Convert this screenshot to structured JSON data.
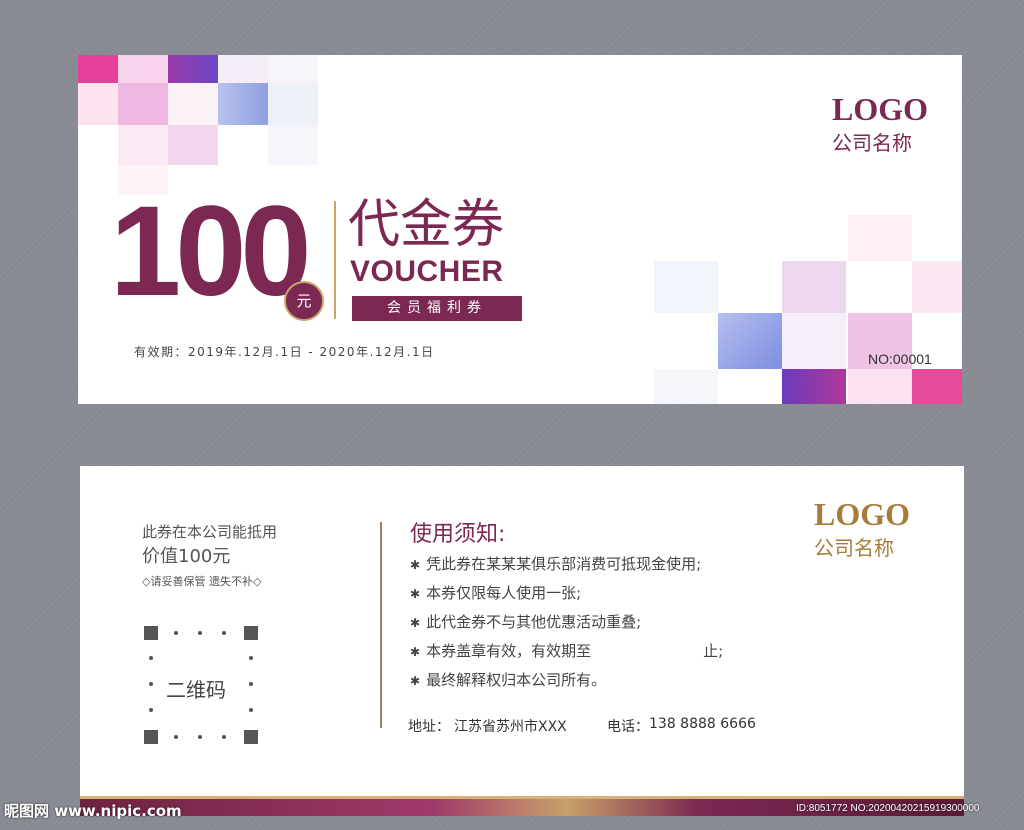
{
  "front": {
    "amount": "100",
    "currency_badge": "元",
    "title_cn": "代金券",
    "title_en": "VOUCHER",
    "member_label": "会员福利券",
    "validity": "有效期：2019年.12月.1日 - 2020年.12月.1日",
    "logo": "LOGO",
    "company": "公司名称",
    "serial": "NO:00001",
    "colors": {
      "brand": "#7b2852",
      "gold": "#c9a56a",
      "magenta": "#e8469c",
      "violet": "#7a4bc4"
    }
  },
  "back": {
    "deduct_line": "此券在本公司能抵用",
    "value_line": "价值100元",
    "keep_note": "◇请妥善保管 遗失不补◇",
    "qr_label": "二维码",
    "notice_title": "使用须知:",
    "rules": [
      "凭此券在某某某俱乐部消费可抵现金使用;",
      "本券仅限每人使用一张;",
      "此代金券不与其他优惠活动重叠;",
      "本券盖章有效，有效期至",
      "最终解释权归本公司所有。"
    ],
    "rule_until_suffix": "止;",
    "address_label": "地址：",
    "address_value": "江苏省苏州市XXX",
    "phone_label": "电话：",
    "phone_value": "138 8888 6666",
    "logo": "LOGO",
    "company": "公司名称",
    "colors": {
      "gold": "#a67c3c"
    }
  },
  "watermark": {
    "site": "昵图网 www.nipic.com",
    "id_text": "ID:8051772 NO:20200420215919300000"
  }
}
